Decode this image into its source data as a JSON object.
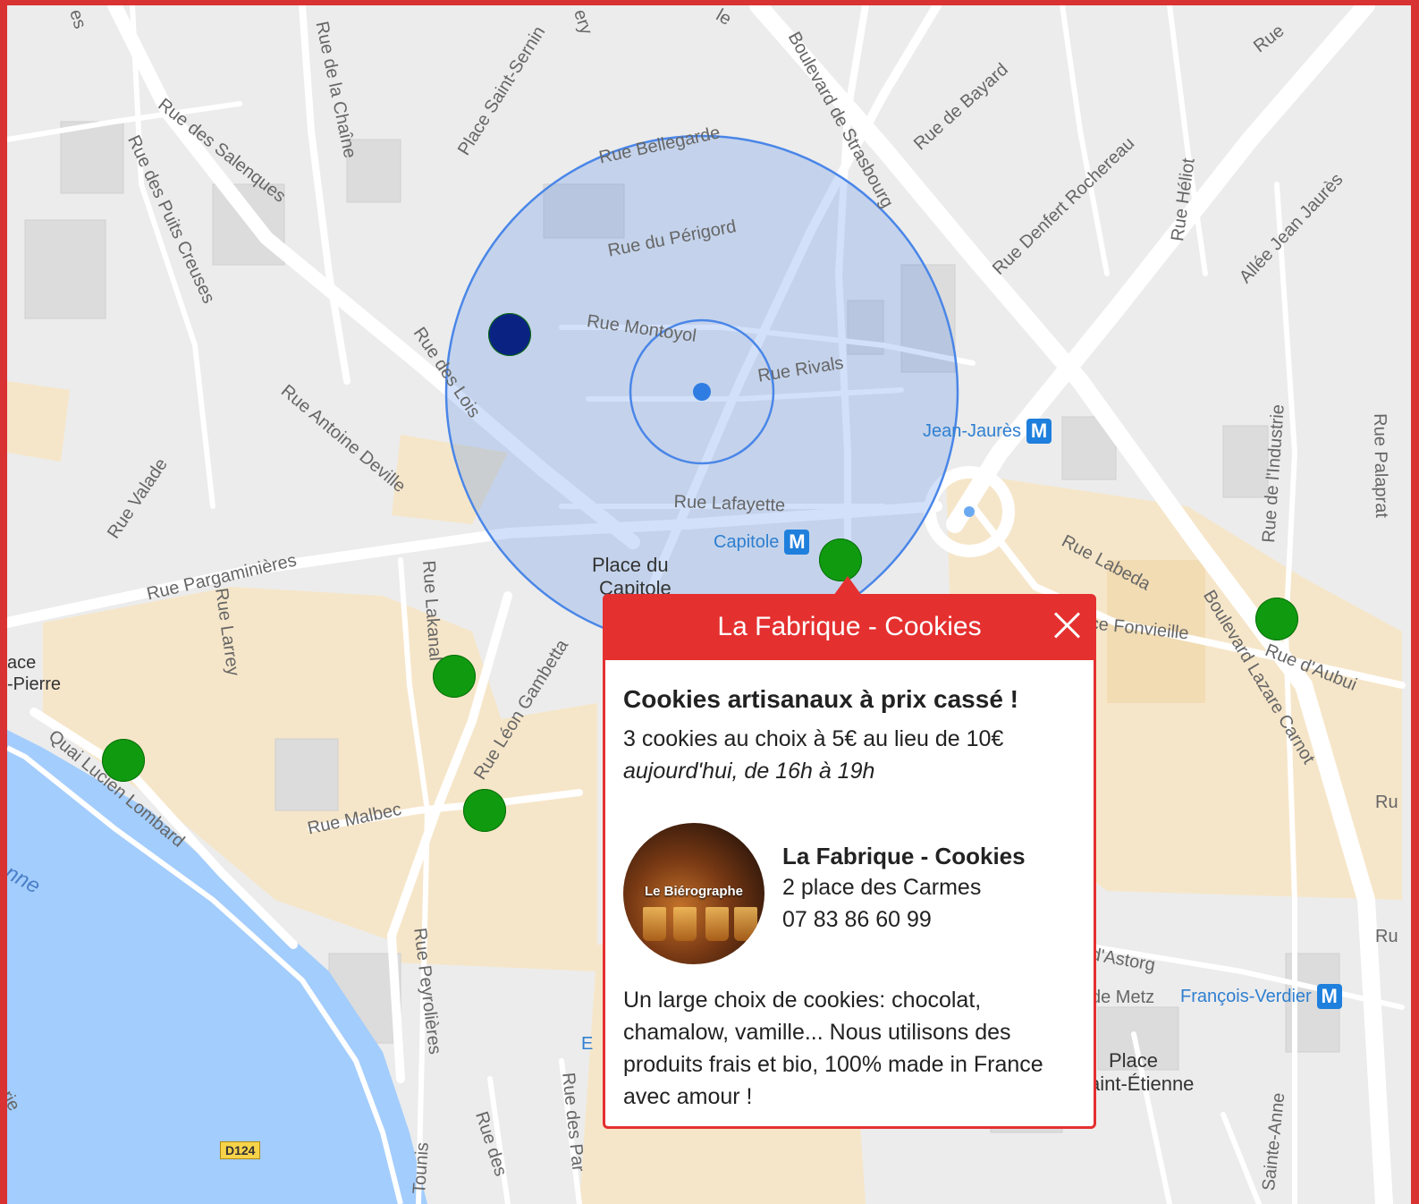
{
  "popup": {
    "title": "La Fabrique - Cookies",
    "offer_title": "Cookies artisanaux à prix cassé !",
    "offer_description": "3 cookies au choix à 5€ au lieu de 10€",
    "offer_time": "aujourd'hui, de 16h à 19h",
    "avatar_text": "Le Biérographe",
    "shop_name": "La Fabrique - Cookies",
    "shop_address": "2 place des Carmes",
    "shop_phone": "07 83 86 60 99",
    "shop_description": "Un large choix de cookies: chocolat, chamalow, vamille... Nous utilisons des produits frais et bio, 100% made in France avec amour !",
    "header_color": "#e53030"
  },
  "map": {
    "street_labels": {
      "rue_des_salenques": "Rue des Salenques",
      "rue_de_la_chaine": "Rue de la Chaîne",
      "place_saint_sernin": "Place Saint-Sernin",
      "rue_bellegarde": "Rue Bellegarde",
      "boulevard_de_strasbourg": "Boulevard de Strasbourg",
      "rue_de_bayard": "Rue de Bayard",
      "rue_denfert_rochereau": "Rue Denfert Rochereau",
      "rue_heliot": "Rue Héliot",
      "allee_jean_jaures": "Allée Jean Jaurès",
      "rue_des_puits_creuses": "Rue des Puits Creuses",
      "rue_du_perigord": "Rue du Périgord",
      "rue_montoyol": "Rue Montoyol",
      "rue_rivals": "Rue Rivals",
      "rue_des_lois": "Rue des Lois",
      "rue_antoine_deville": "Rue Antoine Deville",
      "rue_valade": "Rue Valade",
      "rue_lafayette": "Rue Lafayette",
      "rue_pargaminieres": "Rue Pargaminières",
      "rue_larrey": "Rue Larrey",
      "rue_lakanal": "Rue Lakanal",
      "rue_leon_gambetta": "Rue Léon Gambetta",
      "rue_malbec": "Rue Malbec",
      "quai_lucien_lombard": "Quai Lucien Lombard",
      "rue_peyrolieres": "Rue Peyrolières",
      "rue_labeda": "Rue Labeda",
      "place_fonvieille": "ce Fonvieille",
      "boulevard_lazare_carnot": "Boulevard Lazare Carnot",
      "rue_d_aubuisson": "Rue d'Aubui",
      "rue_de_l_industrie": "Rue de l'Industrie",
      "rue_palaprat": "Rue Palaprat",
      "rue_d_astorg": "d'Astorg",
      "rue_de_metz": "de Metz",
      "rue_sainte_anne": "Sainte-Anne",
      "rue_des_par": "Rue des Par",
      "rue_des": "Rue des",
      "place_saint_pierre_1": "ace",
      "place_saint_pierre_2": "-Pierre",
      "river": "nne",
      "tounis": "Tounis",
      "rue_top": "Rue",
      "edge_ru_1": "Ru",
      "edge_ru_2": "Ru",
      "edge_e": "E",
      "edge_erie": "erie",
      "edge_es": "es",
      "edge_ry": "ery",
      "edge_le": "le"
    },
    "places": {
      "place_du_capitole_1": "Place du",
      "place_du_capitole_2": "Capitole",
      "place_saint_etienne_1": "Place",
      "place_saint_etienne_2": "aint-Étienne"
    },
    "metro_stations": {
      "jean_jaures": "Jean-Jaurès",
      "capitole": "Capitole",
      "francois_verdier": "François-Verdier",
      "metro_symbol": "M"
    },
    "road_badge": "D124",
    "marker_color_default": "#109a10",
    "marker_color_selected": "#0a2383",
    "radius_circle_color": "#4a86e8"
  }
}
